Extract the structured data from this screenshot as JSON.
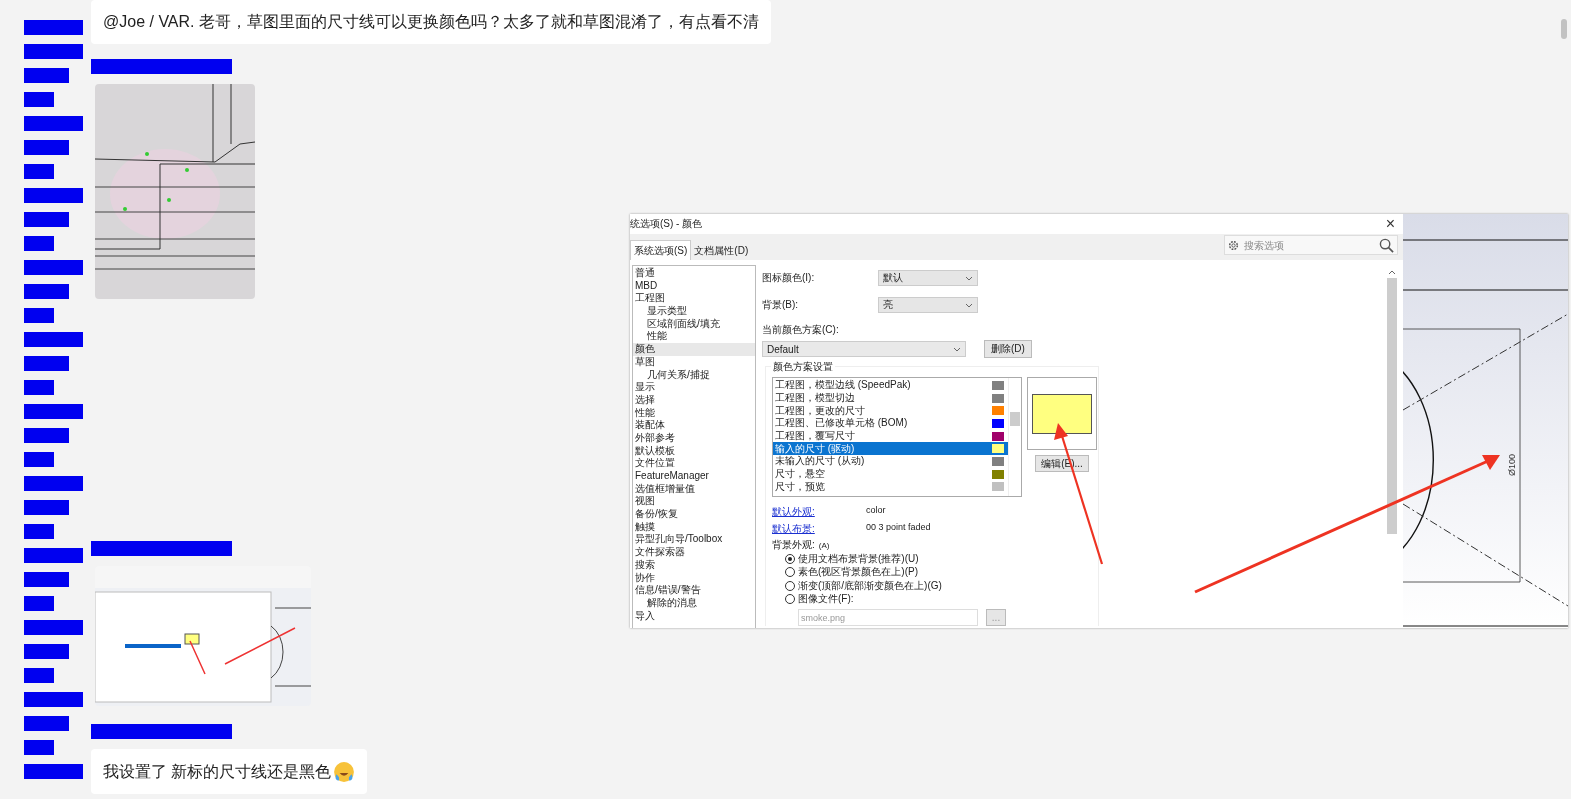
{
  "contacts": [
    {
      "kind": "long"
    },
    {
      "kind": "long"
    },
    {
      "kind": "mid"
    },
    {
      "kind": "short"
    },
    {
      "kind": "long"
    },
    {
      "kind": "mid"
    },
    {
      "kind": "short"
    },
    {
      "kind": "long"
    },
    {
      "kind": "mid"
    },
    {
      "kind": "short"
    },
    {
      "kind": "long"
    },
    {
      "kind": "mid"
    },
    {
      "kind": "short"
    },
    {
      "kind": "long"
    },
    {
      "kind": "mid"
    },
    {
      "kind": "short"
    },
    {
      "kind": "long"
    },
    {
      "kind": "mid"
    },
    {
      "kind": "short"
    },
    {
      "kind": "long"
    },
    {
      "kind": "mid"
    },
    {
      "kind": "short"
    },
    {
      "kind": "long"
    },
    {
      "kind": "mid"
    },
    {
      "kind": "short"
    },
    {
      "kind": "long"
    },
    {
      "kind": "mid"
    },
    {
      "kind": "short"
    },
    {
      "kind": "long"
    },
    {
      "kind": "mid"
    },
    {
      "kind": "short"
    },
    {
      "kind": "long"
    }
  ],
  "messages": [
    {
      "kind": "text",
      "text": "@Joe / VAR. 老哥，草图里面的尺寸线可以更换颜色吗？太多了就和草图混淆了，有点看不清"
    },
    {
      "kind": "picture",
      "sender": {
        "kind": "redacted"
      }
    },
    {
      "kind": "thumbnail",
      "sender": {
        "kind": "redacted"
      }
    },
    {
      "kind": "text",
      "sender": {
        "kind": "redacted"
      },
      "text": "我设置了  新标的尺寸线还是黑色",
      "emoji": {
        "kind": "tears-of-joy"
      }
    }
  ],
  "preview": {
    "dialog": {
      "title": "统选项(S) - 颜色",
      "close": "×",
      "tabs": [
        {
          "label": "系统选项(S)",
          "selected": true
        },
        {
          "label": "文档属性(D)",
          "selected": false
        }
      ],
      "search": {
        "placeholder": "搜索选项"
      },
      "tree": [
        {
          "label": "普通",
          "selected": false
        },
        {
          "label": "MBD",
          "selected": false
        },
        {
          "label": "工程图",
          "selected": false,
          "children": [
            {
              "label": "显示类型",
              "selected": false
            },
            {
              "label": "区域剖面线/填充",
              "selected": false
            },
            {
              "label": "性能",
              "selected": false
            }
          ]
        },
        {
          "label": "颜色",
          "selected": true
        },
        {
          "label": "草图",
          "selected": false,
          "children": [
            {
              "label": "几何关系/捕捉",
              "selected": false
            }
          ]
        },
        {
          "label": "显示",
          "selected": false
        },
        {
          "label": "选择",
          "selected": false
        },
        {
          "label": "性能",
          "selected": false
        },
        {
          "label": "装配体",
          "selected": false
        },
        {
          "label": "外部参考",
          "selected": false
        },
        {
          "label": "默认模板",
          "selected": false
        },
        {
          "label": "文件位置",
          "selected": false
        },
        {
          "label": "FeatureManager",
          "selected": false
        },
        {
          "label": "选值框增量值",
          "selected": false
        },
        {
          "label": "视图",
          "selected": false
        },
        {
          "label": "备份/恢复",
          "selected": false
        },
        {
          "label": "触摸",
          "selected": false
        },
        {
          "label": "异型孔向导/Toolbox",
          "selected": false
        },
        {
          "label": "文件探索器",
          "selected": false
        },
        {
          "label": "搜索",
          "selected": false
        },
        {
          "label": "协作",
          "selected": false
        },
        {
          "label": "信息/错误/警告",
          "selected": false,
          "children": [
            {
              "label": "解除的消息",
              "selected": false
            }
          ]
        },
        {
          "label": "导入",
          "selected": false
        }
      ],
      "icon_color": {
        "label": "图标颜色(I):",
        "value": "默认"
      },
      "background": {
        "label": "背景(B):",
        "value": "亮"
      },
      "scheme": {
        "label": "当前颜色方案(C):",
        "value": "Default",
        "delete_button": "删除(D)"
      },
      "scheme_settings": {
        "title": "颜色方案设置",
        "items": [
          {
            "label": "工程图，模型边线 (SpeedPak)",
            "color": "#808080",
            "selected": false
          },
          {
            "label": "工程图，模型切边",
            "color": "#808080",
            "selected": false
          },
          {
            "label": "工程图，更改的尺寸",
            "color": "#ff8000",
            "selected": false
          },
          {
            "label": "工程图、已修改单元格 (BOM)",
            "color": "#0000ff",
            "selected": false
          },
          {
            "label": "工程图，覆写尺寸",
            "color": "#a0006a",
            "selected": false
          },
          {
            "label": "输入的尺寸 (驱动)",
            "color": "#ffff80",
            "selected": true
          },
          {
            "label": "未输入的尺寸 (从动)",
            "color": "#808080",
            "selected": false
          },
          {
            "label": "尺寸，悬空",
            "color": "#808000",
            "selected": false
          },
          {
            "label": "尺寸，预览",
            "color": "#c0c0c0",
            "selected": false
          }
        ],
        "edit_button": "编辑(E)..."
      },
      "appearance": {
        "link": "默认外观:",
        "value": "color"
      },
      "scene": {
        "link": "默认布景:",
        "value": "00 3 point faded"
      },
      "bg_appearance": {
        "label": "背景外观:",
        "hint": "(A)",
        "options": [
          {
            "label": "使用文档布景背景(推荐)(U)",
            "selected": true
          },
          {
            "label": "素色(视区背景颜色在上)(P)",
            "selected": false
          },
          {
            "label": "渐变(顶部/底部渐变颜色在上)(G)",
            "selected": false
          },
          {
            "label": "图像文件(F):",
            "selected": false
          }
        ],
        "file": "smoke.png",
        "browse": "..."
      }
    },
    "drawing": {
      "dimension": "Ø100"
    }
  }
}
